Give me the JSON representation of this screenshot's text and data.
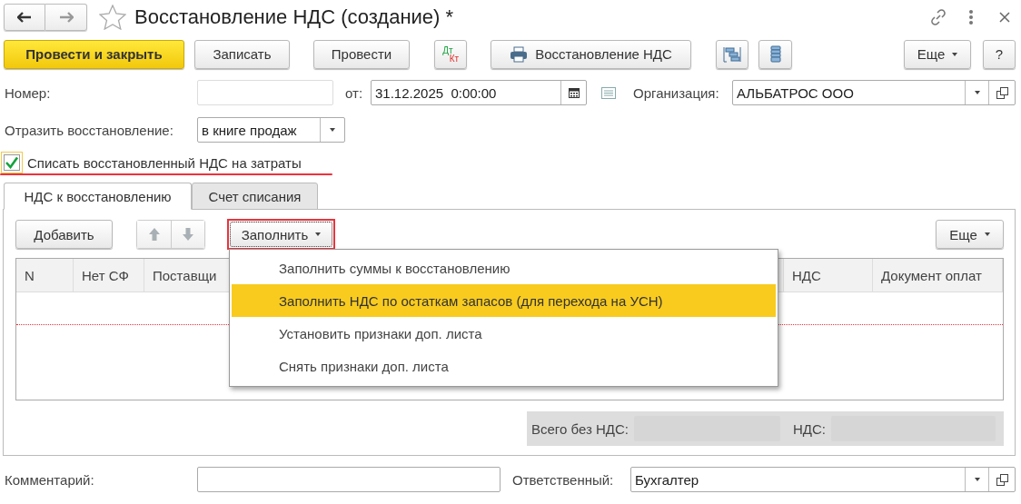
{
  "window": {
    "title": "Восстановление НДС (создание) *"
  },
  "toolbar": {
    "post_close": "Провести и закрыть",
    "save": "Записать",
    "post": "Провести",
    "dt": "Дт",
    "kt": "Кт",
    "print": "Восстановление НДС",
    "more": "Еще",
    "help": "?"
  },
  "form": {
    "number_label": "Номер:",
    "date_label": "от:",
    "date": "31.12.2025  0:00:00",
    "org_label": "Организация:",
    "org": "АЛЬБАТРОС ООО",
    "reflect_label": "Отразить восстановление:",
    "reflect": "в книге продаж",
    "writeoff": {
      "label": "Списать восстановленный НДС на затраты",
      "checked": true
    }
  },
  "tabs": [
    {
      "label": "НДС к восстановлению",
      "selected": true
    },
    {
      "label": "Счет списания",
      "selected": false
    }
  ],
  "table_toolbar": {
    "add": "Добавить",
    "fill": "Заполнить",
    "more": "Еще"
  },
  "fill_menu": [
    {
      "label": "Заполнить суммы к восстановлению",
      "selected": false
    },
    {
      "label": "Заполнить НДС по остаткам запасов (для перехода на УСН)",
      "selected": true
    },
    {
      "label": "Установить признаки доп. листа",
      "selected": false
    },
    {
      "label": "Снять признаки доп. листа",
      "selected": false
    }
  ],
  "table": {
    "columns": [
      "N",
      "Нет СФ",
      "Поставщи",
      "НДС",
      "Документ оплат"
    ]
  },
  "totals": {
    "net_label": "Всего без НДС:",
    "vat_label": "НДС:"
  },
  "footer": {
    "comment_label": "Комментарий:",
    "responsible_label": "Ответственный:",
    "responsible": "Бухгалтер"
  }
}
